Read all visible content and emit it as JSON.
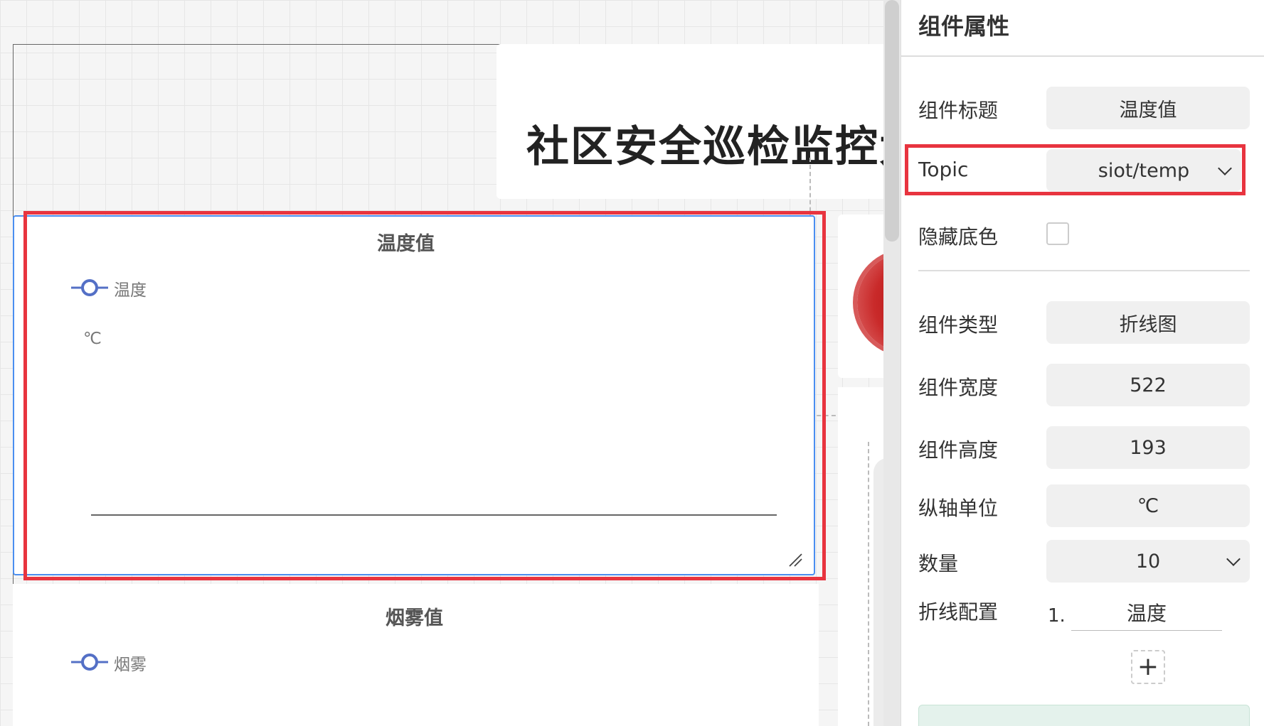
{
  "canvas": {
    "dashboard_title": "社区安全巡检监控大屏",
    "widgets": [
      {
        "title": "温度值",
        "legend": "温度",
        "unit": "℃"
      },
      {
        "title": "烟雾值",
        "legend": "烟雾"
      }
    ]
  },
  "panel": {
    "title": "组件属性",
    "fields": {
      "component_title": {
        "label": "组件标题",
        "value": "温度值"
      },
      "topic": {
        "label": "Topic",
        "value": "siot/temp"
      },
      "hide_background": {
        "label": "隐藏底色",
        "checked": false
      },
      "component_type": {
        "label": "组件类型",
        "value": "折线图"
      },
      "component_width": {
        "label": "组件宽度",
        "value": "522"
      },
      "component_height": {
        "label": "组件高度",
        "value": "193"
      },
      "y_axis_unit": {
        "label": "纵轴单位",
        "value": "℃"
      },
      "count": {
        "label": "数量",
        "value": "10"
      },
      "line_config": {
        "label": "折线配置",
        "items": [
          {
            "index": "1.",
            "name": "温度"
          }
        ]
      }
    },
    "add_label": "+"
  },
  "colors": {
    "accent_blue": "#4a8ef0",
    "highlight_red": "#e8343f",
    "legend_blue": "#5470c6",
    "alarm_red": "#c92a2a"
  },
  "icons": {
    "legend": "line-circle-legend-icon",
    "resize": "resize-handle-icon",
    "dropdown": "chevron-down-icon"
  }
}
